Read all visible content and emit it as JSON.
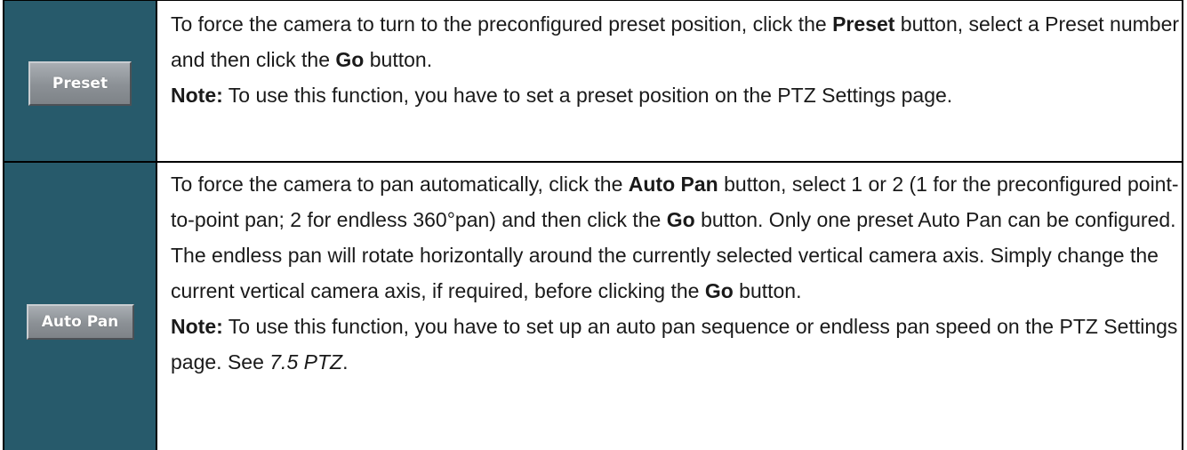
{
  "preset": {
    "button_label": "Preset",
    "desc_1": "To force the camera to turn to the preconfigured preset position, click the ",
    "desc_bold_1": "Preset",
    "desc_2": " button, select a Preset number and then click the ",
    "desc_bold_2": "Go",
    "desc_3": " button.",
    "note_label": "Note:",
    "note_text": " To use this function, you have to set a preset position on the PTZ Settings page."
  },
  "auto_pan": {
    "button_label": "Auto Pan",
    "desc_1": "To force the camera to pan automatically, click the ",
    "desc_bold_1": "Auto Pan",
    "desc_2": " button, select 1 or 2 (1 for the preconfigured point-to-point pan; 2 for endless 360°pan) and then click the ",
    "desc_bold_2": "Go",
    "desc_3": " button. Only one preset Auto Pan can be configured. The endless pan will rotate horizontally around the currently selected vertical camera axis. Simply change the current vertical camera axis, if required, before clicking the ",
    "desc_bold_3": "Go",
    "desc_4": " button.",
    "note_label": "Note:",
    "note_text": " To use this function, you have to set up an auto pan sequence or endless pan speed on the PTZ Settings page. See ",
    "note_ref": "7.5 PTZ",
    "note_end": "."
  },
  "colors": {
    "icon_cell_bg": "#275a6b",
    "button_face": "#8b9095",
    "button_text": "#ffffff"
  }
}
